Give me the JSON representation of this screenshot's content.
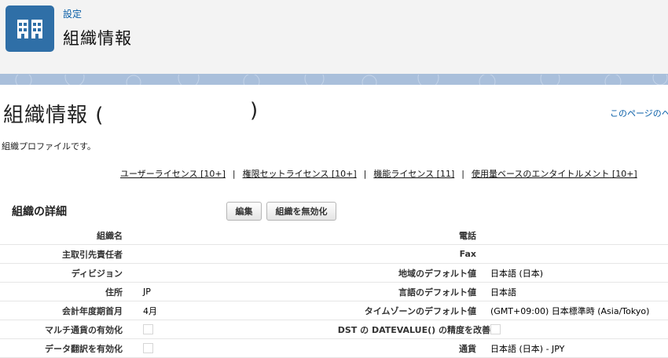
{
  "header": {
    "breadcrumb": "設定",
    "title": "組織情報",
    "logo_icon": "building-icon"
  },
  "page": {
    "title": "組織情報",
    "title_open": "(",
    "title_close": ")",
    "help_link": "このページのヘル",
    "subtitle": "組織プロファイルです。"
  },
  "links": [
    {
      "label": "ユーザーライセンス",
      "count": "[10+]"
    },
    {
      "label": "権限セットライセンス",
      "count": "[10+]"
    },
    {
      "label": "機能ライセンス",
      "count": "[11]"
    },
    {
      "label": "使用量ベースのエンタイトルメント",
      "count": "[10+]"
    }
  ],
  "link_separator": "|",
  "section": {
    "title": "組織の詳細",
    "edit_button": "編集",
    "deactivate_button": "組織を無効化"
  },
  "rows": [
    {
      "left_label": "組織名",
      "left_value": "",
      "right_label": "電話",
      "right_value": ""
    },
    {
      "left_label": "主取引先責任者",
      "left_value": "",
      "right_label": "Fax",
      "right_value": ""
    },
    {
      "left_label": "ディビジョン",
      "left_value": "",
      "right_label": "地域のデフォルト値",
      "right_value": "日本語 (日本)"
    },
    {
      "left_label": "住所",
      "left_value": "JP",
      "right_label": "言語のデフォルト値",
      "right_value": "日本語"
    },
    {
      "left_label": "会計年度期首月",
      "left_value": "4月",
      "right_label": "タイムゾーンのデフォルト値",
      "right_value": "(GMT+09:00) 日本標準時 (Asia/Tokyo)"
    },
    {
      "left_label": "マルチ通貨の有効化",
      "left_value": "",
      "right_label": "DST の DATEVALUE() の精度を改善",
      "right_value": ""
    },
    {
      "left_label": "データ翻訳を有効化",
      "left_value": "",
      "right_label": "通貨",
      "right_value": "日本語 (日本) - JPY"
    }
  ]
}
